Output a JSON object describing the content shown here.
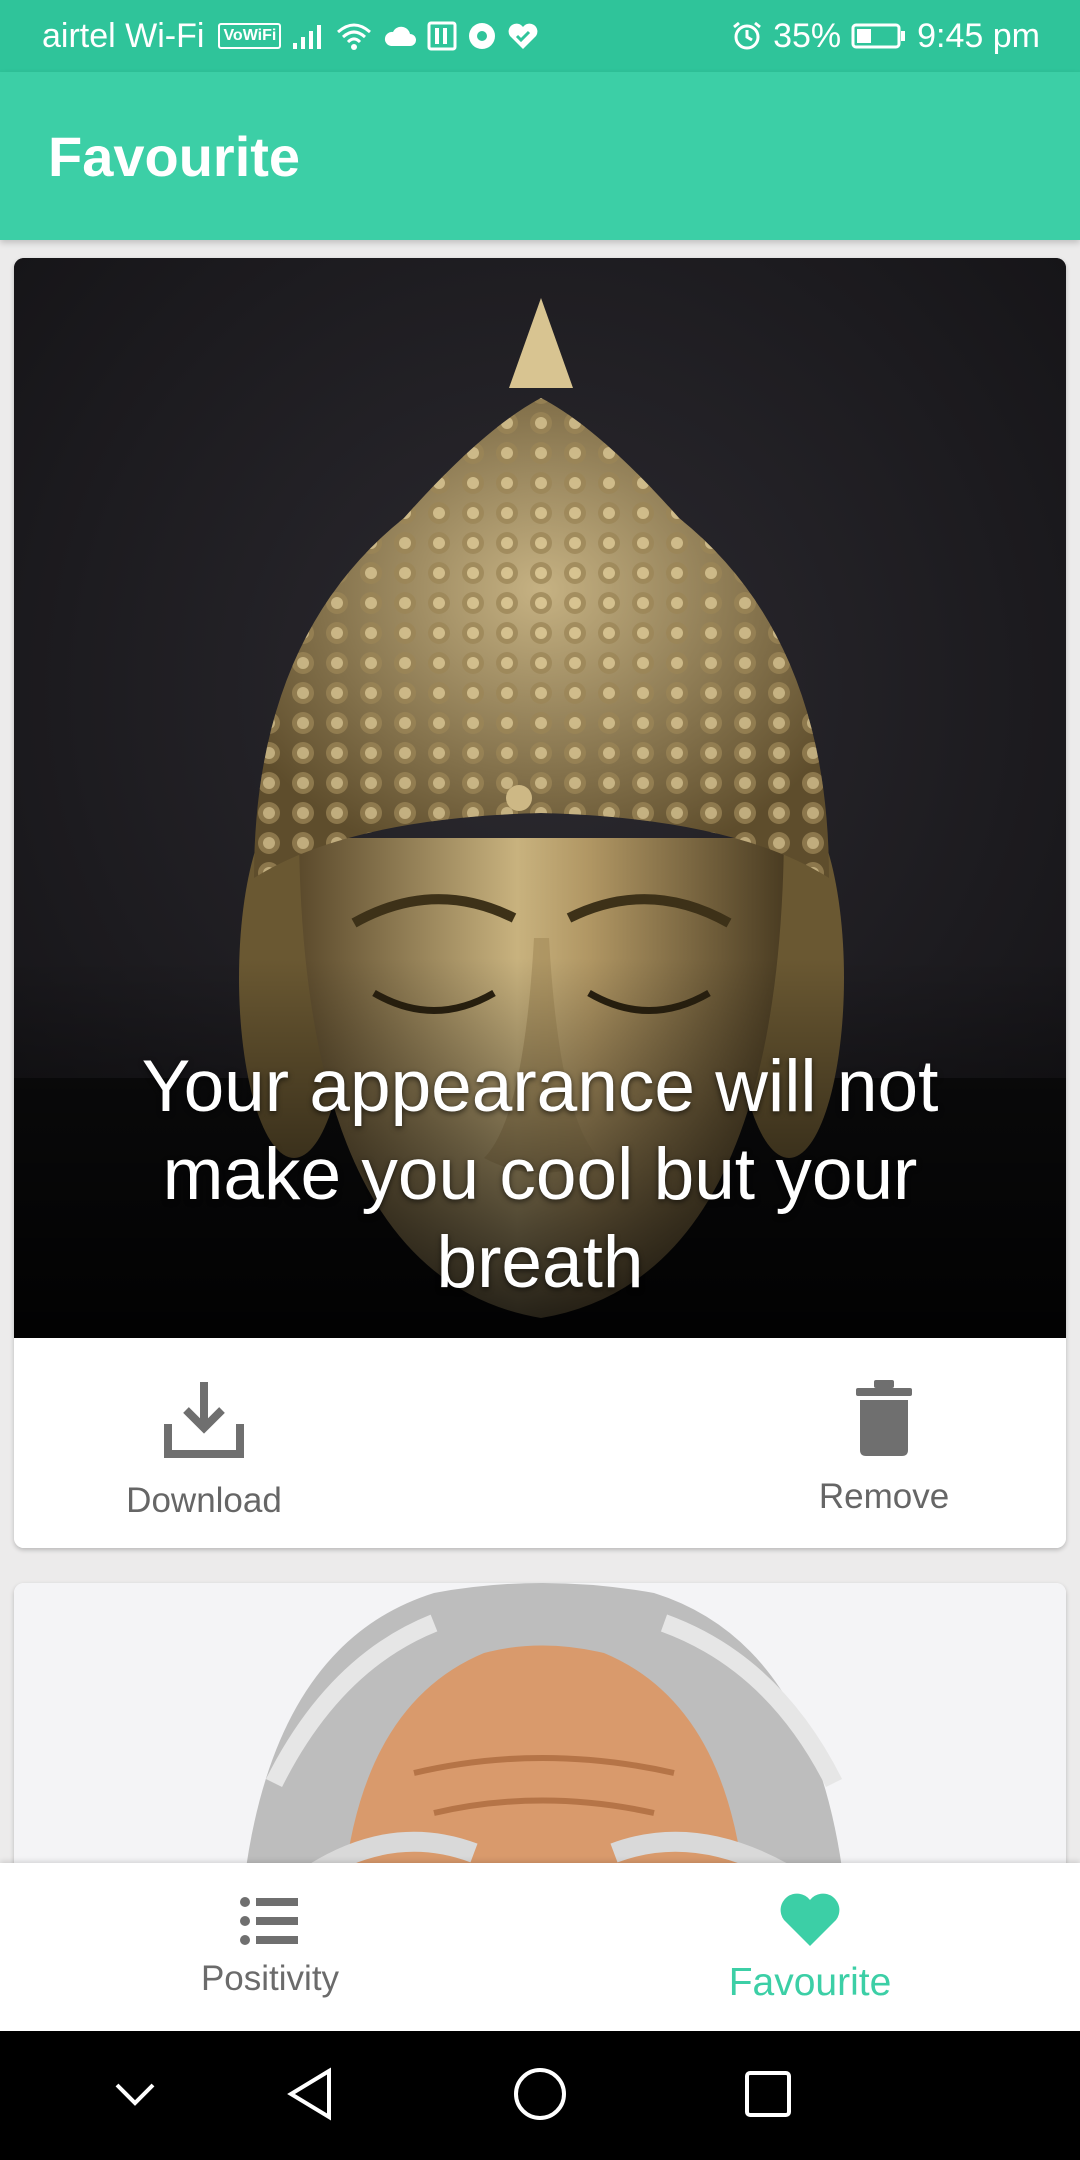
{
  "status_bar": {
    "carrier": "airtel Wi-Fi",
    "volte": "VoWiFi",
    "battery": "35%",
    "time": "9:45 pm"
  },
  "app_bar": {
    "title": "Favourite"
  },
  "cards": [
    {
      "quote": "Your appearance will not make you cool but your breath",
      "download_label": "Download",
      "remove_label": "Remove"
    }
  ],
  "bottom_nav": {
    "items": [
      {
        "label": "Positivity",
        "icon": "list-icon"
      },
      {
        "label": "Favourite",
        "icon": "heart-icon",
        "selected": true
      }
    ]
  },
  "colors": {
    "accent": "#3ccfa6",
    "status_bar": "#2fc49a",
    "text_secondary": "#666666"
  }
}
